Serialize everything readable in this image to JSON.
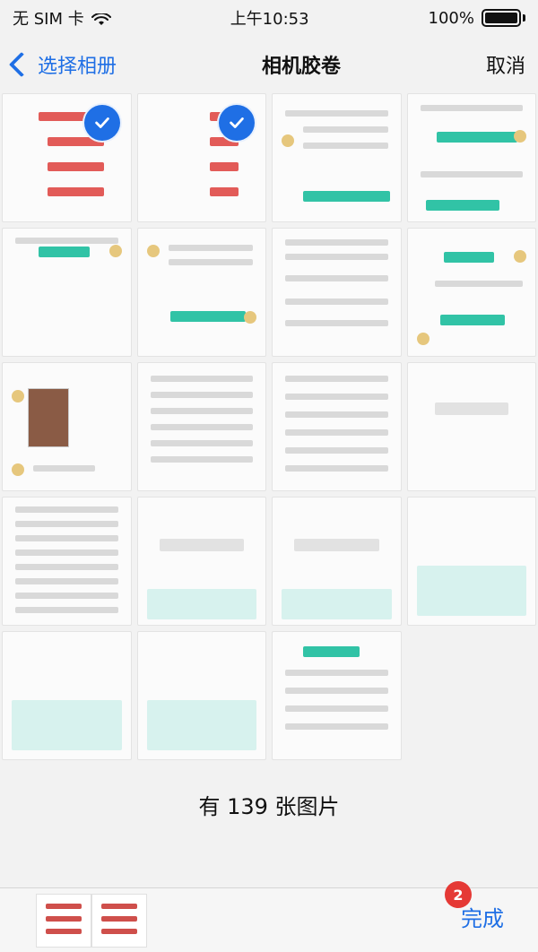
{
  "status_bar": {
    "carrier": "无 SIM 卡",
    "time": "上午10:53",
    "battery": "100%"
  },
  "nav": {
    "back_label": "选择相册",
    "title": "相机胶卷",
    "cancel_label": "取消"
  },
  "grid": {
    "photo_count_text": "有 139 张图片"
  },
  "bottom_bar": {
    "done_label": "完成",
    "selected_count": "2"
  },
  "colors": {
    "accent": "#1f6fe5",
    "badge": "#e53935",
    "teal": "#31c3a6",
    "red": "#e25b58"
  },
  "icons": {
    "back": "chevron-left-icon",
    "check": "check-circle-icon",
    "wifi": "wifi-icon",
    "battery": "battery-icon"
  }
}
